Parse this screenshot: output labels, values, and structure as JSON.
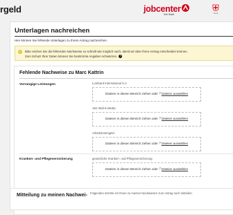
{
  "header": {
    "title_fragment": "rgeld",
    "logo_text": "jobcenter",
    "logo_tagline": "Ihre Stadt",
    "crest_caption": "Stadt"
  },
  "main": {
    "section_title": "Unterlagen nachreichen",
    "intro": "Hier können Sie fehlende Unterlagen zu Ihrem Antrag nachreichen.",
    "notice": {
      "line1": "Bitte reichen Sie die fehlenden Nachweise so schnell wie möglich nach, damit wir über Ihren Antrag entscheiden können.",
      "line2": "Zum Schutz Ihrer Daten können Sie bestimmte Angaben schwärzen."
    },
    "missing": {
      "title": "Fehlende Nachweise zu Marc Kattrin",
      "groups": [
        {
          "label": "Vorrangige Leistungen",
          "items": [
            {
              "label": "Lombard International S.A"
            },
            {
              "label": "1&1 Mail & Media"
            },
            {
              "label": "Arbeitslosengeld"
            }
          ]
        },
        {
          "label": "Kranken- und Pflegeversicherung",
          "items": [
            {
              "label": "gesetzliche Kranken- und Pflegeversicherung"
            }
          ]
        }
      ],
      "dropzone": {
        "text": "Dateien in diesen Bereich ziehen oder",
        "link": "Dateien auswählen"
      }
    },
    "bottom": {
      "title": "Mitteilung zu meinen Nachwei-",
      "text": "Folgendes möchte ich Ihnen zu meinen Nachweisen zum Antrag noch mitteilen:"
    }
  },
  "colors": {
    "brand": "#d0021b",
    "notice_bg": "#fdf6d3"
  }
}
